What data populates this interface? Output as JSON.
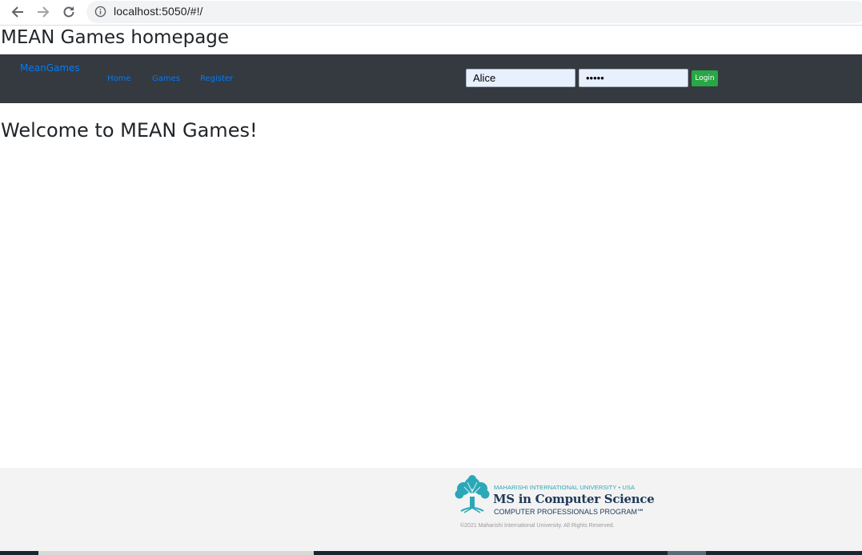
{
  "browser": {
    "url": "localhost:5050/#!/"
  },
  "page": {
    "heading": "MEAN Games homepage",
    "welcome": "Welcome to MEAN Games!"
  },
  "navbar": {
    "brand": "MeanGames",
    "links": [
      "Home",
      "Games",
      "Register"
    ],
    "username_value": "Alice",
    "password_value": "•••••",
    "login_label": "Login"
  },
  "footer": {
    "logo_line1": "MAHARISHI INTERNATIONAL UNIVERSITY • USA",
    "logo_line2": "MS in Computer Science",
    "logo_line3": "COMPUTER PROFESSIONALS PROGRAM℠",
    "copyright": "©2021 Maharishi International University. All Rights Reserved."
  },
  "colors": {
    "navbar_bg": "#343a40",
    "link": "#007bff",
    "login_button": "#28a745",
    "footer_bg": "#f3f3f3"
  },
  "icons": [
    "back-arrow-icon",
    "forward-arrow-icon",
    "reload-icon",
    "info-icon",
    "tree-logo-icon"
  ]
}
